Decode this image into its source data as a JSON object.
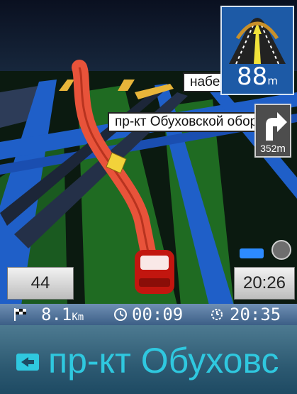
{
  "map": {
    "street_label_primary": "пр-кт Обуховской обороны",
    "street_label_secondary": "набережная"
  },
  "lane_guidance": {
    "distance_value": "88",
    "distance_unit": "m",
    "icon": "lane-guidance-icon"
  },
  "next_turn": {
    "direction": "right",
    "icon": "turn-right-icon",
    "distance_value": "352",
    "distance_unit": "m"
  },
  "speed_display": {
    "value": "44"
  },
  "clock_display": {
    "value": "20:26"
  },
  "status": {
    "distance_value": "8.1",
    "distance_unit": "Km",
    "distance_icon": "finish-flag-icon",
    "remaining_time": "00:09",
    "remaining_time_icon": "timer-icon",
    "arrival_time": "20:35",
    "arrival_icon": "arrival-clock-icon"
  },
  "street_bar": {
    "current_street": "пр-кт Обуховс",
    "icon": "street-sign-icon"
  },
  "colors": {
    "route": "#e8533a",
    "road_blue": "#1f5fc8",
    "grass": "#1f6b22",
    "label_text": "#2fc8df"
  }
}
